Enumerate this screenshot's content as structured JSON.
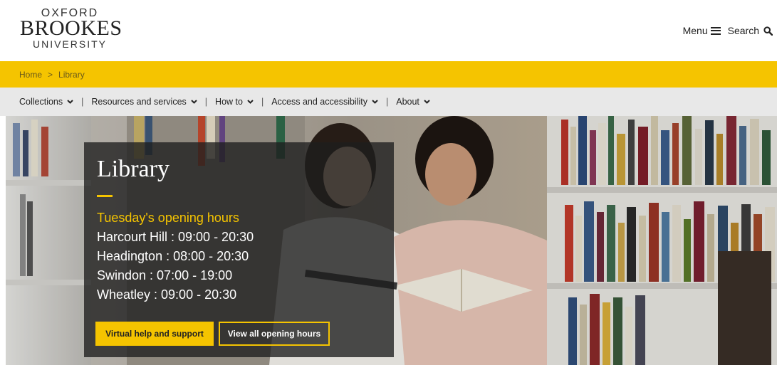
{
  "logo": {
    "line1": "OXFORD",
    "line2": "BROOKES",
    "line3": "UNIVERSITY"
  },
  "header": {
    "menu_label": "Menu",
    "search_label": "Search",
    "menu_icon": "hamburger-icon",
    "search_icon": "search-icon"
  },
  "breadcrumb": {
    "home": "Home",
    "separator": ">",
    "current": "Library"
  },
  "nav": {
    "items": [
      {
        "label": "Collections"
      },
      {
        "label": "Resources and services"
      },
      {
        "label": "How to"
      },
      {
        "label": "Access and accessibility"
      },
      {
        "label": "About"
      }
    ],
    "separator": "|"
  },
  "hero": {
    "title": "Library",
    "hours_title": "Tuesday's opening hours",
    "hours": [
      "Harcourt Hill : 09:00 - 20:30",
      "Headington : 08:00 - 20:30",
      "Swindon : 07:00 - 19:00",
      "Wheatley : 09:00 - 20:30"
    ],
    "primary_button": "Virtual help and support",
    "secondary_button": "View all opening hours"
  },
  "colors": {
    "accent": "#f5c400",
    "nav_bg": "#e8e8e8",
    "panel_bg": "#1e1e1e"
  }
}
